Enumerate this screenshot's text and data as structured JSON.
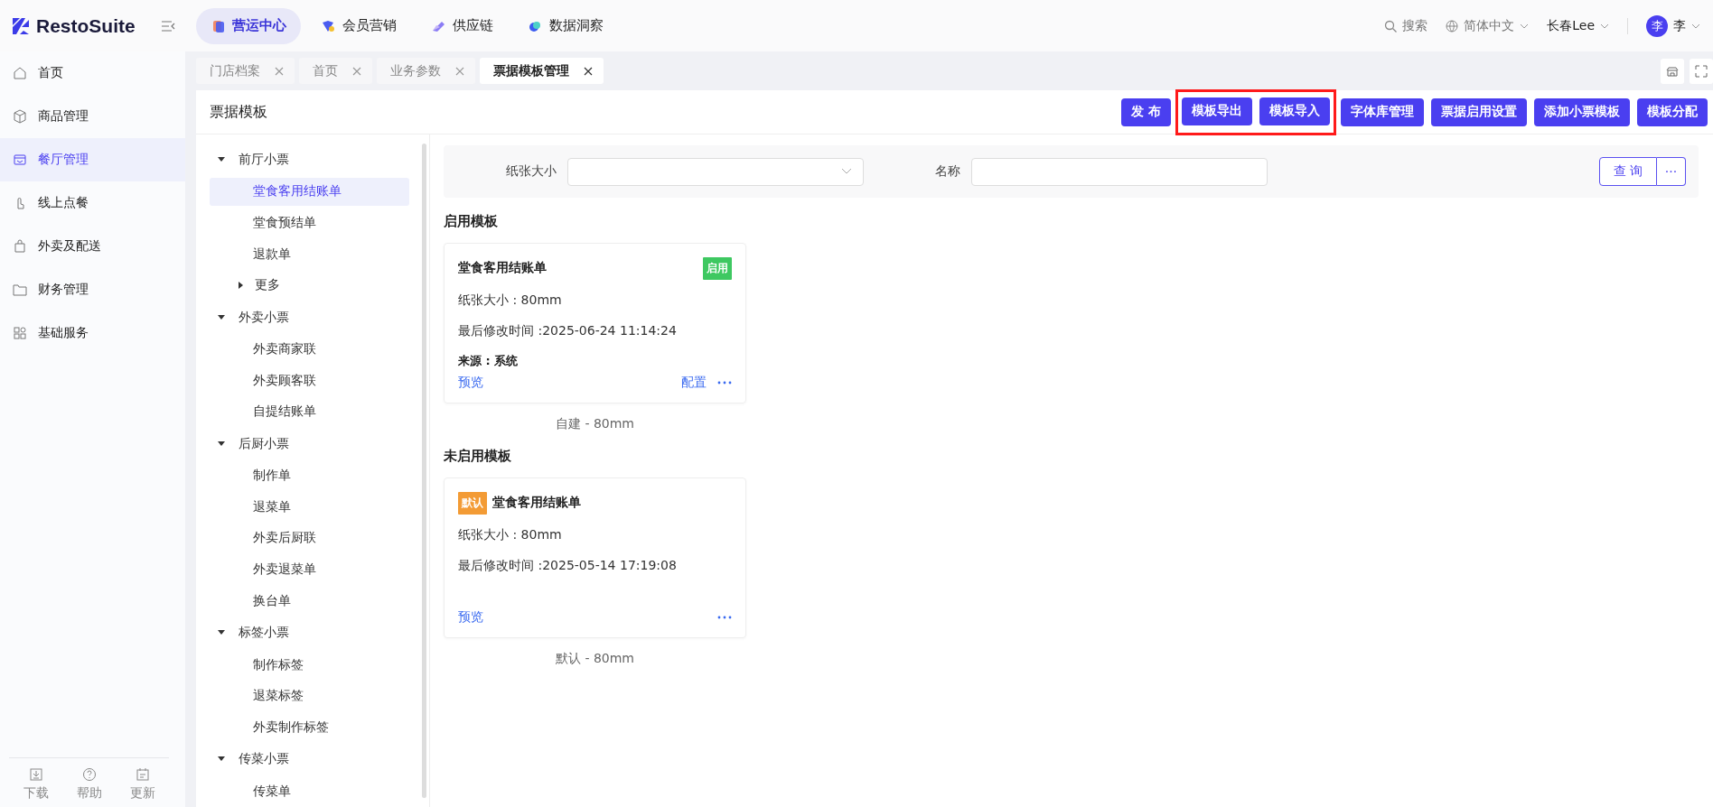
{
  "brand": {
    "name": "RestoSuite"
  },
  "top_nav": [
    {
      "label": "营运中心",
      "selected": true
    },
    {
      "label": "会员营销",
      "selected": false
    },
    {
      "label": "供应链",
      "selected": false
    },
    {
      "label": "数据洞察",
      "selected": false
    }
  ],
  "header_right": {
    "search": "搜索",
    "language": "简体中文",
    "store": "长春Lee",
    "avatar": "李",
    "user": "李"
  },
  "sidebar": {
    "items": [
      {
        "label": "首页",
        "selected": false
      },
      {
        "label": "商品管理",
        "selected": false
      },
      {
        "label": "餐厅管理",
        "selected": true
      },
      {
        "label": "线上点餐",
        "selected": false
      },
      {
        "label": "外卖及配送",
        "selected": false
      },
      {
        "label": "财务管理",
        "selected": false
      },
      {
        "label": "基础服务",
        "selected": false
      }
    ],
    "footer": [
      "下载",
      "帮助",
      "更新"
    ]
  },
  "page_tabs": [
    {
      "label": "门店档案",
      "selected": false
    },
    {
      "label": "首页",
      "selected": false
    },
    {
      "label": "业务参数",
      "selected": false
    },
    {
      "label": "票据模板管理",
      "selected": true
    }
  ],
  "page": {
    "title": "票据模板",
    "buttons": [
      {
        "label": "发 布",
        "highlighted": false
      },
      {
        "label": "模板导出",
        "highlighted": true
      },
      {
        "label": "模板导入",
        "highlighted": true
      },
      {
        "label": "字体库管理",
        "highlighted": false
      },
      {
        "label": "票据启用设置",
        "highlighted": false
      },
      {
        "label": "添加小票模板",
        "highlighted": false
      },
      {
        "label": "模板分配",
        "highlighted": false
      }
    ]
  },
  "tree": [
    {
      "label": "前厅小票",
      "expanded": true,
      "children": [
        {
          "label": "堂食客用结账单",
          "selected": true
        },
        {
          "label": "堂食预结单",
          "selected": false
        },
        {
          "label": "退款单",
          "selected": false
        },
        {
          "label": "更多",
          "selected": false,
          "expanded": false
        }
      ]
    },
    {
      "label": "外卖小票",
      "expanded": true,
      "children": [
        {
          "label": "外卖商家联",
          "selected": false
        },
        {
          "label": "外卖顾客联",
          "selected": false
        },
        {
          "label": "自提结账单",
          "selected": false
        }
      ]
    },
    {
      "label": "后厨小票",
      "expanded": true,
      "children": [
        {
          "label": "制作单",
          "selected": false
        },
        {
          "label": "退菜单",
          "selected": false
        },
        {
          "label": "外卖后厨联",
          "selected": false
        },
        {
          "label": "外卖退菜单",
          "selected": false
        },
        {
          "label": "换台单",
          "selected": false
        }
      ]
    },
    {
      "label": "标签小票",
      "expanded": true,
      "children": [
        {
          "label": "制作标签",
          "selected": false
        },
        {
          "label": "退菜标签",
          "selected": false
        },
        {
          "label": "外卖制作标签",
          "selected": false
        }
      ]
    },
    {
      "label": "传菜小票",
      "expanded": true,
      "children": [
        {
          "label": "传菜单",
          "selected": false
        }
      ]
    }
  ],
  "filter": {
    "paper_label": "纸张大小",
    "name_label": "名称",
    "query_button": "查 询",
    "more_button": "···"
  },
  "sections": [
    {
      "title": "启用模板",
      "cards": [
        {
          "title": "堂食客用结账单",
          "badge": {
            "label": "启用",
            "kind": "enabled"
          },
          "paper": "纸张大小 : 80mm",
          "modified": "最后修改时间 :2025-06-24 11:14:24",
          "source": "来源 : 系统",
          "preview": "预览",
          "configure": "配置",
          "caption": "自建 - 80mm"
        }
      ]
    },
    {
      "title": "未启用模板",
      "cards": [
        {
          "title": "堂食客用结账单",
          "badge": {
            "label": "默认",
            "kind": "default"
          },
          "paper": "纸张大小 : 80mm",
          "modified": "最后修改时间 :2025-05-14 17:19:08",
          "preview": "预览",
          "caption": "默认 - 80mm"
        }
      ]
    }
  ]
}
